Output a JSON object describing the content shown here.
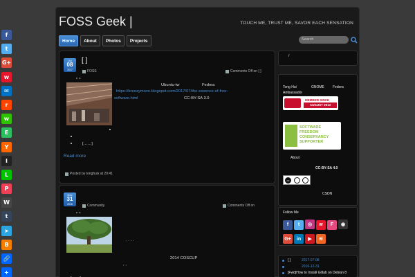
{
  "share_bar": [
    {
      "name": "facebook",
      "glyph": "f",
      "color": "#3b5998"
    },
    {
      "name": "twitter",
      "glyph": "t",
      "color": "#55acee"
    },
    {
      "name": "google-plus",
      "glyph": "G+",
      "color": "#dd4b39"
    },
    {
      "name": "weibo",
      "glyph": "w",
      "color": "#e6162d"
    },
    {
      "name": "email",
      "glyph": "✉",
      "color": "#0072c6"
    },
    {
      "name": "reddit",
      "glyph": "r",
      "color": "#ff4500"
    },
    {
      "name": "wechat",
      "glyph": "w",
      "color": "#2dc100"
    },
    {
      "name": "evernote",
      "glyph": "E",
      "color": "#2dbe60"
    },
    {
      "name": "hackernews",
      "glyph": "Y",
      "color": "#ff6600"
    },
    {
      "name": "instapaper",
      "glyph": "I",
      "color": "#222"
    },
    {
      "name": "line",
      "glyph": "L",
      "color": "#00c300"
    },
    {
      "name": "pocket",
      "glyph": "P",
      "color": "#ee4056"
    },
    {
      "name": "wordpress",
      "glyph": "W",
      "color": "#464646"
    },
    {
      "name": "tumblr",
      "glyph": "t",
      "color": "#35465c"
    },
    {
      "name": "telegram",
      "glyph": "➤",
      "color": "#2ca5e0"
    },
    {
      "name": "blogger",
      "glyph": "B",
      "color": "#f57d00"
    },
    {
      "name": "copy-link",
      "glyph": "🔗",
      "color": "#0166ff"
    },
    {
      "name": "more",
      "glyph": "+",
      "color": "#0166ff"
    }
  ],
  "header": {
    "title": "FOSS Geek |",
    "tagline": "TOUCH ME, TRUST ME, SAVOR EACH SENSATION"
  },
  "nav": {
    "home": "Home",
    "about": "About",
    "photos": "Photos",
    "projects": "Projects"
  },
  "search": {
    "placeholder": "Search"
  },
  "post1": {
    "month": "Jul",
    "day": "08",
    "year": "2017",
    "title": "[ ]",
    "category": "FOSS",
    "comments": "Comments Off on [ ]",
    "quote": "“ “",
    "line1a": "Ubuntu-tw",
    "line1b": "Fedora",
    "link_line1": "https://breezymove.blogspot.com/2017/07/the-essence-of-free-",
    "link_line2": "software.html",
    "license": "CC-BY-SA 3.0",
    "ellipsis": "[……]",
    "read_more": "Read more",
    "posted_by": "Posted by tonghuix at 20:41"
  },
  "post2": {
    "month": "Dec",
    "day": "31",
    "year": "2016",
    "category": "Community",
    "comments": "Comments Off on",
    "quote": "“ “",
    "dots": ".    .    .    .",
    "event": "2014 COSCUP",
    "comma": ",   ,",
    "ellipsis": "[……]"
  },
  "sidebar": {
    "top_slash": "/",
    "names": {
      "tong": "Tong Hui",
      "gnome": "GNOME",
      "fedora": "Fedora",
      "ambassador": "Ambassador"
    },
    "badge1_top": "MEMBER SINCE",
    "badge1_bottom": "AUGUST 2013",
    "badge2": "SOFTWARE FREEDOM CONSERVANCY SUPPORTER",
    "about": "About",
    "license": "CC-BY-SA 4.0",
    "cc": "cc",
    "csdn": "CSDN",
    "follow_title": "Follow Me",
    "follow_icons": [
      {
        "name": "facebook",
        "glyph": "f",
        "color": "#3b5998"
      },
      {
        "name": "twitter",
        "glyph": "t",
        "color": "#55acee"
      },
      {
        "name": "instagram",
        "glyph": "◎",
        "color": "#c13584"
      },
      {
        "name": "weibo",
        "glyph": "w",
        "color": "#e6162d"
      },
      {
        "name": "foursquare",
        "glyph": "F",
        "color": "#e64980"
      },
      {
        "name": "github",
        "glyph": "◉",
        "color": "#333"
      },
      {
        "name": "google-plus",
        "glyph": "G+",
        "color": "#dd4b39"
      },
      {
        "name": "linkedin",
        "glyph": "in",
        "color": "#0077b5"
      },
      {
        "name": "youtube",
        "glyph": "▶",
        "color": "#cc181e"
      },
      {
        "name": "rss",
        "glyph": "≋",
        "color": "#f26522"
      }
    ],
    "recent": [
      {
        "title": "[ ]",
        "date": "2017-07-08"
      },
      {
        "title": "",
        "date": "2016-12-31"
      },
      {
        "title": "[Fwd]How to Install Gitlab on Debian 8",
        "date": ""
      }
    ]
  }
}
